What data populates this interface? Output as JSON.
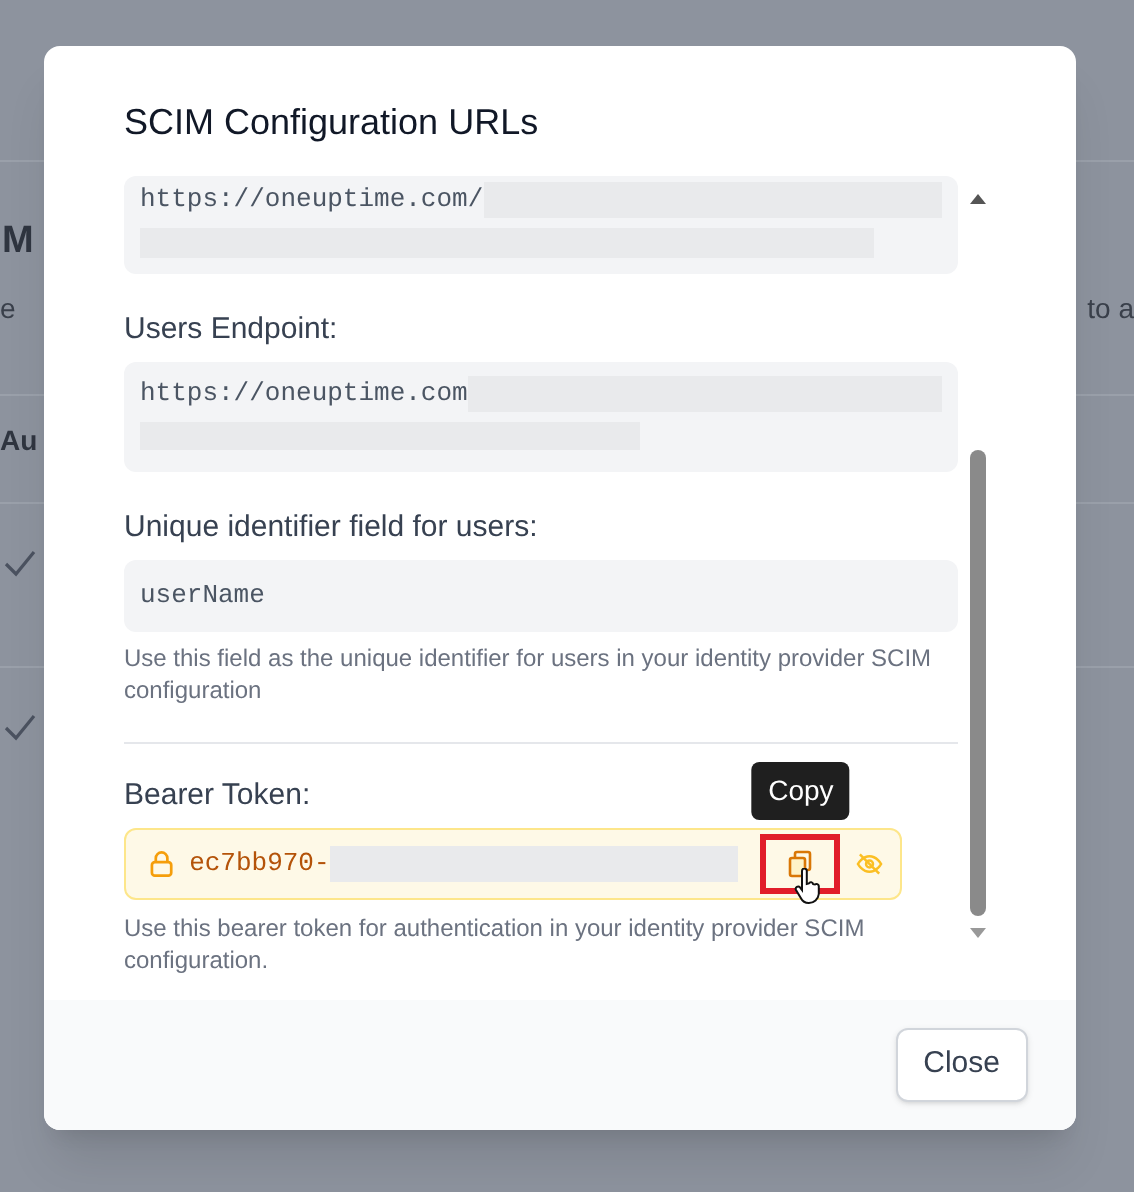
{
  "background": {
    "heading": "M",
    "description_left": "e",
    "description_right": "to a",
    "column_header": "Au",
    "rows": [
      {
        "checked": true
      },
      {
        "checked": true
      }
    ]
  },
  "modal": {
    "title": "SCIM Configuration URLs",
    "fields": [
      {
        "kind": "url",
        "value": "https://oneuptime.com/"
      },
      {
        "kind": "url",
        "label": "Users Endpoint:",
        "value": "https://oneuptime.com"
      },
      {
        "kind": "text",
        "label": "Unique identifier field for users:",
        "value": "userName",
        "help": "Use this field as the unique identifier for users in your identity provider SCIM configuration"
      },
      {
        "kind": "token",
        "label": "Bearer Token:",
        "value": "ec7bb970-",
        "help": "Use this bearer token for authentication in your identity provider SCIM configuration.",
        "tooltip": "Copy"
      }
    ],
    "close_button": "Close"
  }
}
